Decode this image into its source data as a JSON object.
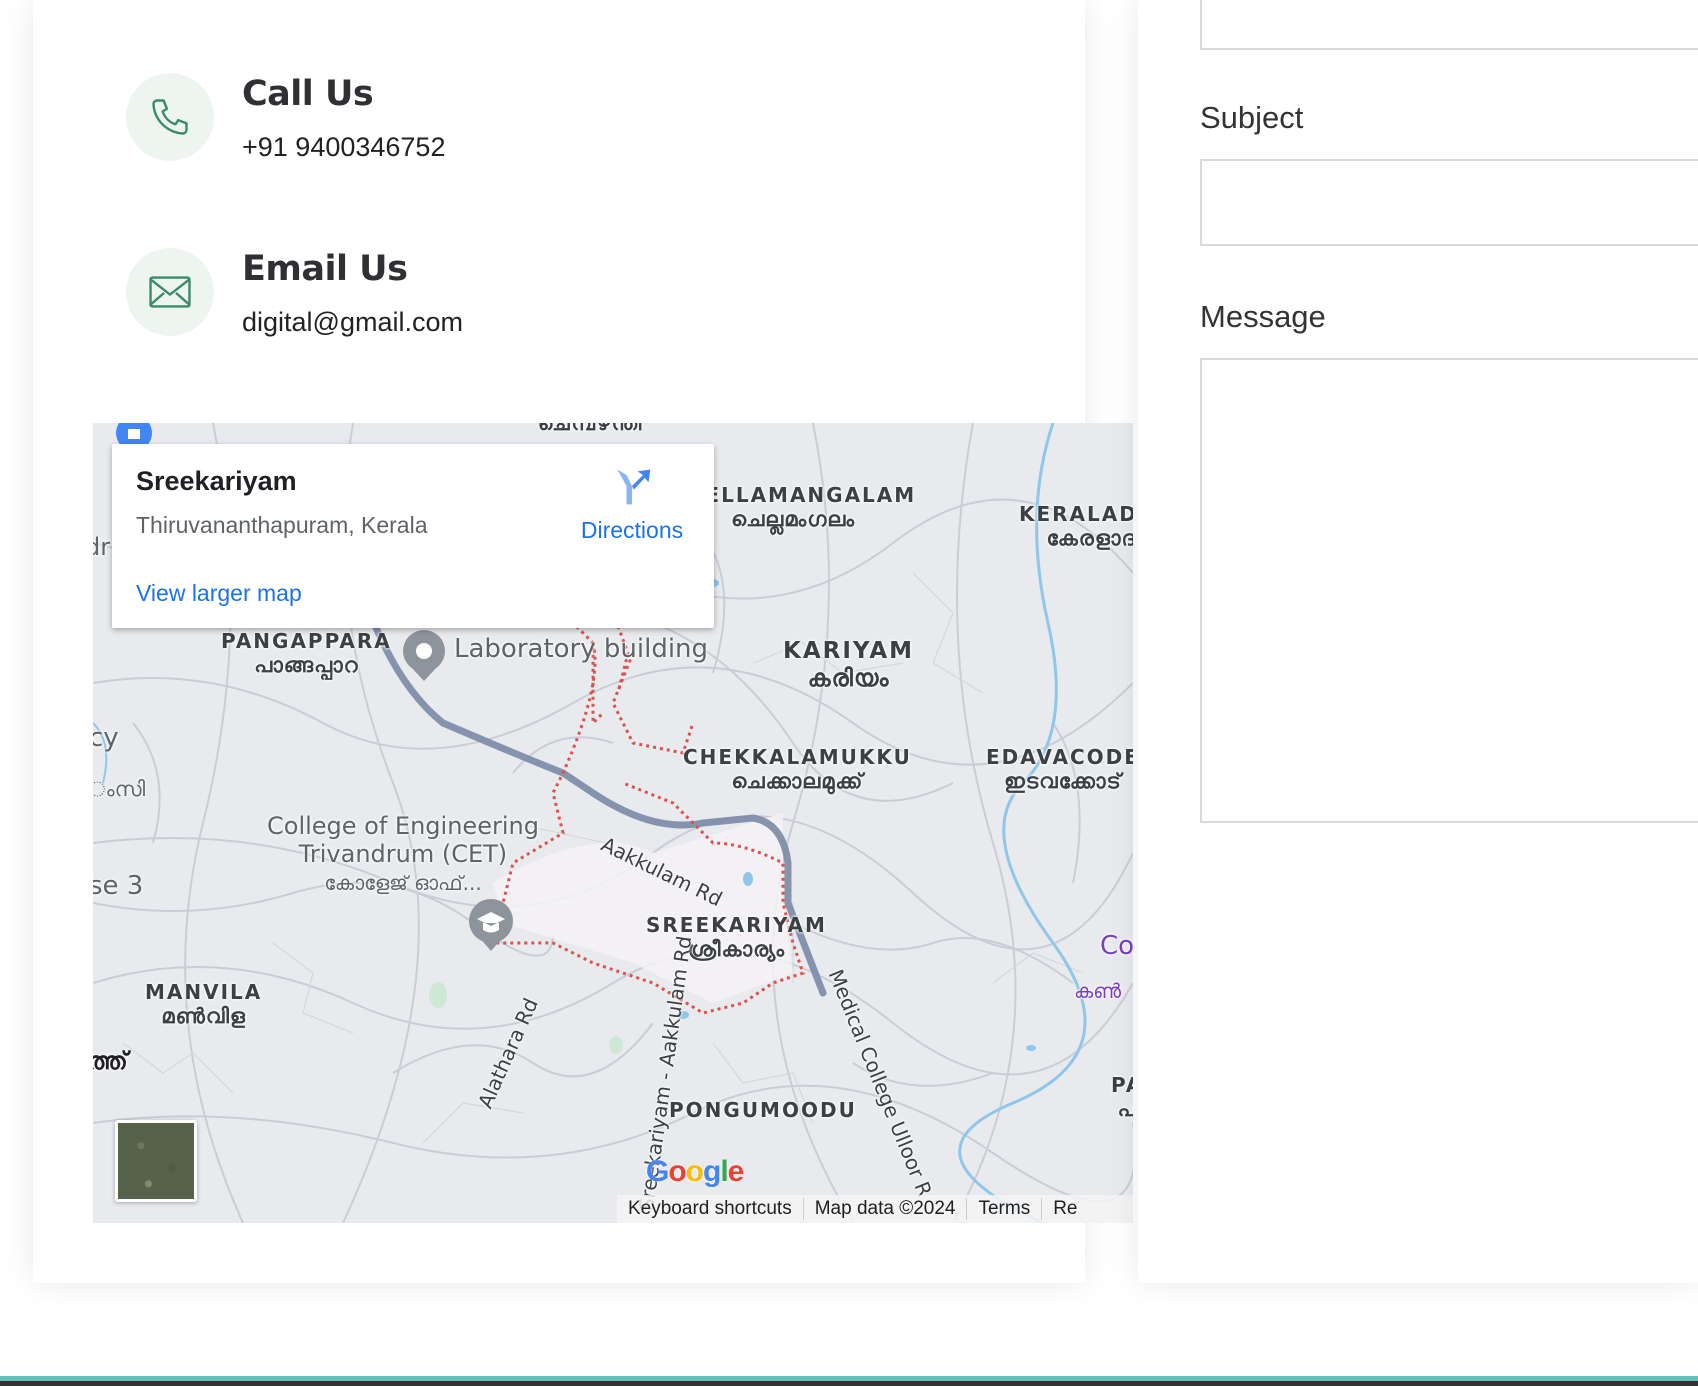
{
  "contact": {
    "call": {
      "title": "Call Us",
      "value": "+91 9400346752",
      "icon": "phone-icon"
    },
    "email": {
      "title": "Email Us",
      "value": "digital@gmail.com",
      "icon": "envelope-icon"
    }
  },
  "map": {
    "popup": {
      "title": "Sreekariyam",
      "address": "Thiruvananthapuram, Kerala",
      "directions_label": "Directions",
      "larger_map_label": "View larger map"
    },
    "labels": {
      "chellamangalam": "CHELLAMANGALAM",
      "chellamangalam_ml": "ചെല്ലമംഗലം",
      "keraladit": "KERALADIT",
      "keraladit_ml": "കേരളാദ",
      "kariyam": "KARIYAM",
      "kariyam_ml": "കരിയം",
      "pangappara": "PANGAPPARA",
      "pangappara_ml": "പാങ്ങപ്പാറ",
      "chekkalamukku": "CHEKKALAMUKKU",
      "chekkalamukku_ml": "ചെക്കാലമുക്ക്",
      "edavacode": "EDAVACODE",
      "edavacode_ml": "ഇടവക്കോട്",
      "sreekariyam": "SREEKARIYAM",
      "sreekariyam_ml": "ശ്രീകാര്യം",
      "manvila": "MANVILA",
      "manvila_ml": "മൺവിള",
      "pongumoodu": "PONGUMOODU",
      "top_ml": "ചെമ്പഴന്തി",
      "edge_cy": "cy",
      "edge_ml_si": "ംസി",
      "edge_se3": "se 3",
      "edge_dr": "dr",
      "edge_thth": "ത്ത്",
      "edge_pa": "PA",
      "edge_pa_ml": "പ",
      "edge_co": "Co",
      "edge_ka_ml": "കൺ"
    },
    "pois": {
      "lab": "Laboratory building",
      "cet_1": "College of Engineering",
      "cet_2": "Trivandrum (CET)",
      "cet_ml": "കോളേജ് ഓഫ്..."
    },
    "roads": {
      "aakkulam": "Aakkulam Rd",
      "medical_college": "Medical College Ulloor R",
      "alathara": "Alathara Rd",
      "sreekariyam_aakkulam": "Sreekariyam - Aakkulam Rd"
    },
    "google_logo": "Google",
    "attribution": {
      "keyboard": "Keyboard shortcuts",
      "map_data": "Map data ©2024",
      "terms": "Terms",
      "report": "Re"
    },
    "colors": {
      "route": "#7b8aa6",
      "boundary": "#d9534f",
      "water": "#6fb7e8",
      "road": "#c5cbd3"
    }
  },
  "form": {
    "subject_label": "Subject",
    "message_label": "Message"
  }
}
